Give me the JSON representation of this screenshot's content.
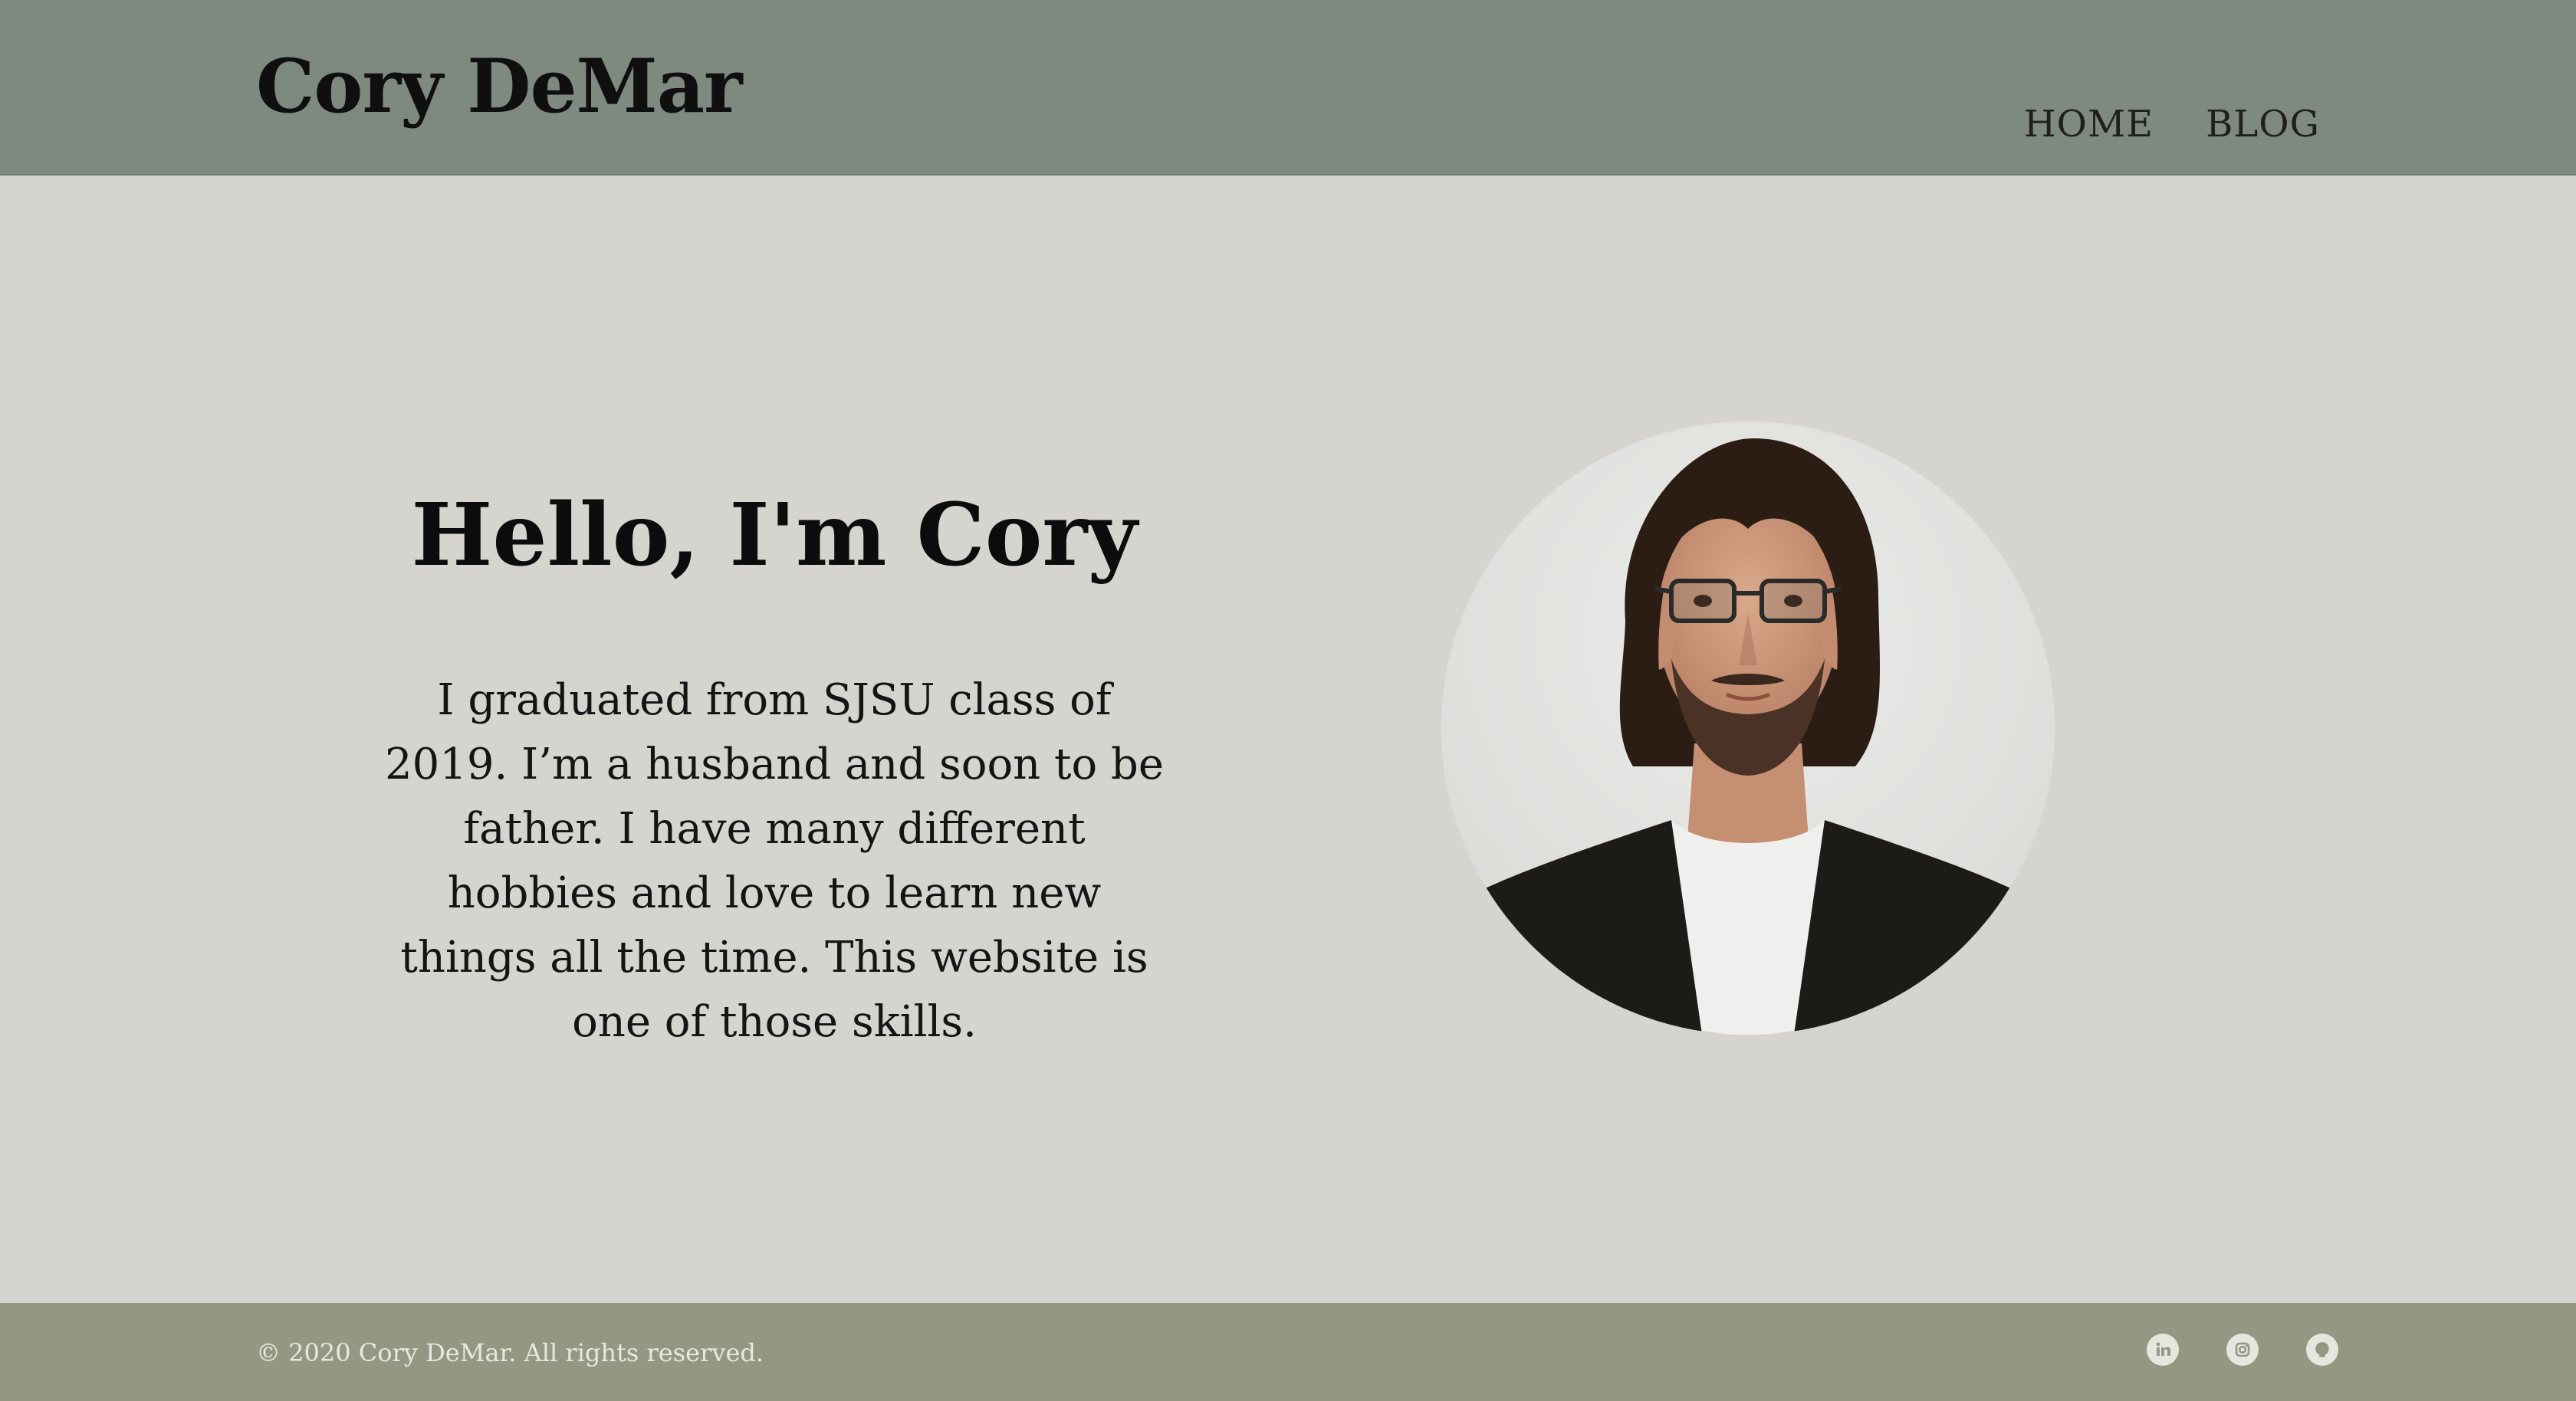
{
  "header": {
    "brand": "Cory DeMar",
    "nav": [
      {
        "label": "HOME"
      },
      {
        "label": "BLOG"
      }
    ]
  },
  "hero": {
    "title": "Hello, I'm Cory",
    "text": "I graduated from SJSU class of 2019. I’m a husband and soon to be father. I have many different hobbies and love to learn new things all the time. This website is one of those skills.",
    "portrait_icon": "portrait-photo"
  },
  "footer": {
    "copyright": "© 2020 Cory DeMar. All rights reserved.",
    "social": [
      {
        "icon": "linkedin-icon"
      },
      {
        "icon": "instagram-icon"
      },
      {
        "icon": "github-icon"
      }
    ]
  },
  "colors": {
    "header_bg": "#7e897f",
    "page_bg": "#d5d4cf",
    "footer_bg": "#939883",
    "text": "#0c0c0c"
  }
}
